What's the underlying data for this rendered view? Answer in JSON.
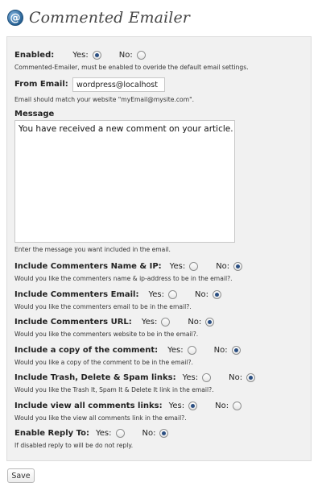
{
  "header": {
    "icon": "at-sign-icon",
    "icon_glyph": "@",
    "title": "Commented Emailer"
  },
  "enabled": {
    "label": "Enabled:",
    "yes": "Yes:",
    "no": "No:",
    "selected": "yes",
    "help": "Commented-Emailer, must be enabled to overide the default email settings."
  },
  "from_email": {
    "label": "From Email:",
    "value": "wordpress@localhost",
    "help": "Email should match your website \"myEmail@mysite.com\"."
  },
  "message": {
    "label": "Message",
    "value": "You have received a new comment on your article.",
    "help": "Enter the message you want included in the email."
  },
  "commenters_name_ip": {
    "label": "Include Commenters Name & IP:",
    "yes": "Yes:",
    "no": "No:",
    "selected": "no",
    "help": "Would you like the commenters name & ip-address to be in the email?."
  },
  "commenters_email": {
    "label": "Include Commenters Email:",
    "yes": "Yes:",
    "no": "No:",
    "selected": "no",
    "help": "Would you like the commenters email to be in the email?."
  },
  "commenters_url": {
    "label": "Include Commenters URL:",
    "yes": "Yes:",
    "no": "No:",
    "selected": "no",
    "help": "Would you like the commenters website to be in the email?."
  },
  "copy_of_comment": {
    "label": "Include a copy of the comment:",
    "yes": "Yes:",
    "no": "No:",
    "selected": "no",
    "help": "Would you like a copy of the comment to be in the email?."
  },
  "trash_spam_links": {
    "label": "Include Trash, Delete & Spam links:",
    "yes": "Yes:",
    "no": "No:",
    "selected": "no",
    "help": "Would you like the Trash It, Spam It & Delete It link in the email?."
  },
  "view_all_comments": {
    "label": "Include view all comments links:",
    "yes": "Yes:",
    "no": "No:",
    "selected": "yes",
    "help": "Would you like the view all comments link in the email?."
  },
  "enable_reply_to": {
    "label": "Enable Reply To:",
    "yes": "Yes:",
    "no": "No:",
    "selected": "no",
    "help": "If disabled reply to will be do not reply."
  },
  "actions": {
    "save_label": "Save"
  },
  "colors": {
    "panel_bg": "#f1f1f1",
    "radio_dot": "#2b4f82",
    "title": "#464646"
  }
}
